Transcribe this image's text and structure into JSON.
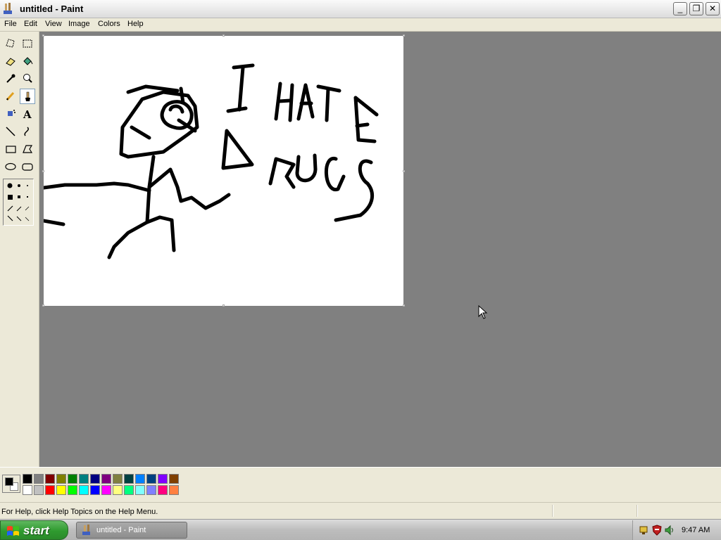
{
  "window": {
    "title": "untitled - Paint",
    "controls": {
      "minimize": "_",
      "maximize": "❐",
      "close": "✕"
    }
  },
  "menu": [
    "File",
    "Edit",
    "View",
    "Image",
    "Colors",
    "Help"
  ],
  "tools": [
    {
      "name": "free-form-select",
      "icon": "free-form-select-icon"
    },
    {
      "name": "select",
      "icon": "rect-select-icon"
    },
    {
      "name": "eraser",
      "icon": "eraser-icon"
    },
    {
      "name": "fill",
      "icon": "paint-bucket-icon"
    },
    {
      "name": "pick-color",
      "icon": "eyedropper-icon"
    },
    {
      "name": "magnifier",
      "icon": "magnifier-icon"
    },
    {
      "name": "pencil",
      "icon": "pencil-icon"
    },
    {
      "name": "brush",
      "icon": "brush-icon",
      "active": true
    },
    {
      "name": "airbrush",
      "icon": "airbrush-icon"
    },
    {
      "name": "text",
      "icon": "text-icon",
      "label": "A"
    },
    {
      "name": "line",
      "icon": "line-icon"
    },
    {
      "name": "curve",
      "icon": "curve-icon"
    },
    {
      "name": "rectangle",
      "icon": "rectangle-icon"
    },
    {
      "name": "polygon",
      "icon": "polygon-icon"
    },
    {
      "name": "ellipse",
      "icon": "ellipse-icon"
    },
    {
      "name": "rounded-rectangle",
      "icon": "rounded-rectangle-icon"
    }
  ],
  "colors": {
    "foreground": "#000000",
    "background": "#ffffff",
    "palette_top": [
      "#000000",
      "#808080",
      "#800000",
      "#808000",
      "#008000",
      "#008080",
      "#000080",
      "#800080",
      "#808040",
      "#004040",
      "#0080ff",
      "#004080",
      "#8000ff",
      "#804000"
    ],
    "palette_bottom": [
      "#ffffff",
      "#c0c0c0",
      "#ff0000",
      "#ffff00",
      "#00ff00",
      "#00ffff",
      "#0000ff",
      "#ff00ff",
      "#ffff80",
      "#00ff80",
      "#80ffff",
      "#8080ff",
      "#ff0080",
      "#ff8040"
    ]
  },
  "status": {
    "help_text": "For Help, click Help Topics on the Help Menu."
  },
  "taskbar": {
    "start_label": "start",
    "task_label": "untitled - Paint",
    "clock": "9:47 AM"
  }
}
